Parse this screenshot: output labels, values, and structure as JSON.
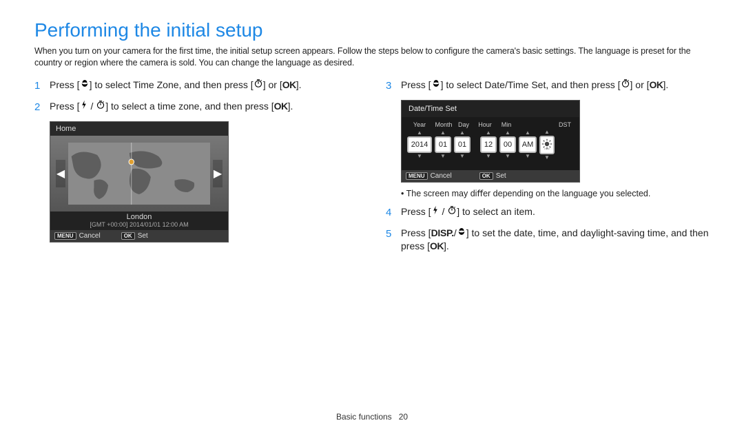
{
  "title": "Performing the initial setup",
  "intro": "When you turn on your camera for the ﬁrst time, the initial setup screen appears. Follow the steps below to conﬁgure the camera's basic settings. The language is preset for the country or region where the camera is sold. You can change the language as desired.",
  "steps": {
    "s1_a": "Press [",
    "s1_b": "] to select Time Zone, and then press [",
    "s1_c": "] or [",
    "s1_d": "].",
    "s2_a": "Press [",
    "s2_b": " / ",
    "s2_c": "] to select a time zone, and then press [",
    "s2_d": "].",
    "s3_a": "Press [",
    "s3_b": "] to select Date/Time Set, and then press [",
    "s3_c": "] or [",
    "s3_d": "].",
    "s4_a": "Press [",
    "s4_b": " / ",
    "s4_c": "] to select an item.",
    "s5_a": "Press [",
    "s5_b": "/",
    "s5_c": "] to set the date, time, and daylight-saving time, and then press [",
    "s5_d": "]."
  },
  "nums": {
    "n1": "1",
    "n2": "2",
    "n3": "3",
    "n4": "4",
    "n5": "5"
  },
  "ok_label": "OK",
  "disp_label": "DISP.",
  "tz": {
    "header": "Home",
    "city": "London",
    "gmt": "[GMT +00:00] 2014/01/01 12:00 AM",
    "cancel": "Cancel",
    "set": "Set",
    "menu_badge": "MENU",
    "ok_badge": "OK"
  },
  "dt": {
    "title": "Date/Time Set",
    "labels": {
      "year": "Year",
      "month": "Month",
      "day": "Day",
      "hour": "Hour",
      "min": "Min",
      "dst": "DST"
    },
    "values": {
      "year": "2014",
      "month": "01",
      "day": "01",
      "hour": "12",
      "min": "00",
      "ampm": "AM"
    },
    "cancel": "Cancel",
    "set": "Set",
    "menu_badge": "MENU",
    "ok_badge": "OK"
  },
  "note_bullet": "•",
  "note_text": "The screen may diﬀer depending on the language you selected.",
  "footer_section": "Basic functions",
  "footer_page": "20"
}
